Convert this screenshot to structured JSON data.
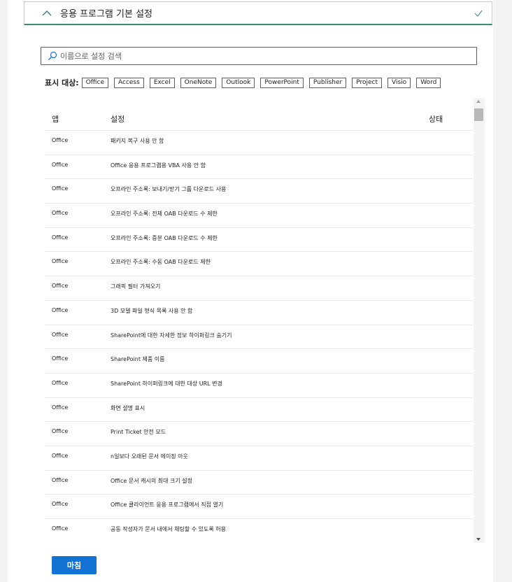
{
  "section": {
    "title": "응용 프로그램 기본 설정",
    "collapse_icon": "chevron-up-icon",
    "status_icon": "checkmark-icon"
  },
  "search": {
    "placeholder": "이름으로 설정 검색",
    "icon": "search-icon"
  },
  "filter": {
    "label": "표시 대상:",
    "chips": [
      "Office",
      "Access",
      "Excel",
      "OneNote",
      "Outlook",
      "PowerPoint",
      "Publisher",
      "Project",
      "Visio",
      "Word"
    ]
  },
  "table": {
    "headers": {
      "app": "앱",
      "setting": "설정",
      "status": "상태"
    },
    "rows": [
      {
        "app": "Office",
        "setting": "패키지 복구 사용 안 함"
      },
      {
        "app": "Office",
        "setting": "Office 응용 프로그램용 VBA 사용 안 함"
      },
      {
        "app": "Office",
        "setting": "오프라인 주소록: 보내기/받기 그룹 다운로드 사용"
      },
      {
        "app": "Office",
        "setting": "오프라인 주소록: 전체 OAB 다운로드 수 제한"
      },
      {
        "app": "Office",
        "setting": "오프라인 주소록: 증분 OAB 다운로드 수 제한"
      },
      {
        "app": "Office",
        "setting": "오프라인 주소록: 수동 OAB 다운로드 제한"
      },
      {
        "app": "Office",
        "setting": "그래픽 필터 가져오기"
      },
      {
        "app": "Office",
        "setting": "3D 모델 파일 형식 목록 사용 안 함"
      },
      {
        "app": "Office",
        "setting": "SharePoint에 대한 자세한 정보 하이퍼링크 숨기기"
      },
      {
        "app": "Office",
        "setting": "SharePoint 제품 이름"
      },
      {
        "app": "Office",
        "setting": "SharePoint 하이퍼링크에 대한 대상 URL 변경"
      },
      {
        "app": "Office",
        "setting": "화면 설명 표시"
      },
      {
        "app": "Office",
        "setting": "Print Ticket 안전 모드"
      },
      {
        "app": "Office",
        "setting": "n일보다 오래된 문서 에이징 아웃"
      },
      {
        "app": "Office",
        "setting": "Office 문서 캐시의 최대 크기 설정"
      },
      {
        "app": "Office",
        "setting": "Office 클라이언트 응용 프로그램에서 직접 열기"
      },
      {
        "app": "Office",
        "setting": "공동 작성자가 문서 내에서 채팅할 수 있도록 허용"
      }
    ]
  },
  "footer": {
    "done_label": "마침"
  },
  "colors": {
    "accent": "#1373d5",
    "header_underline": "#3b8a7a"
  }
}
